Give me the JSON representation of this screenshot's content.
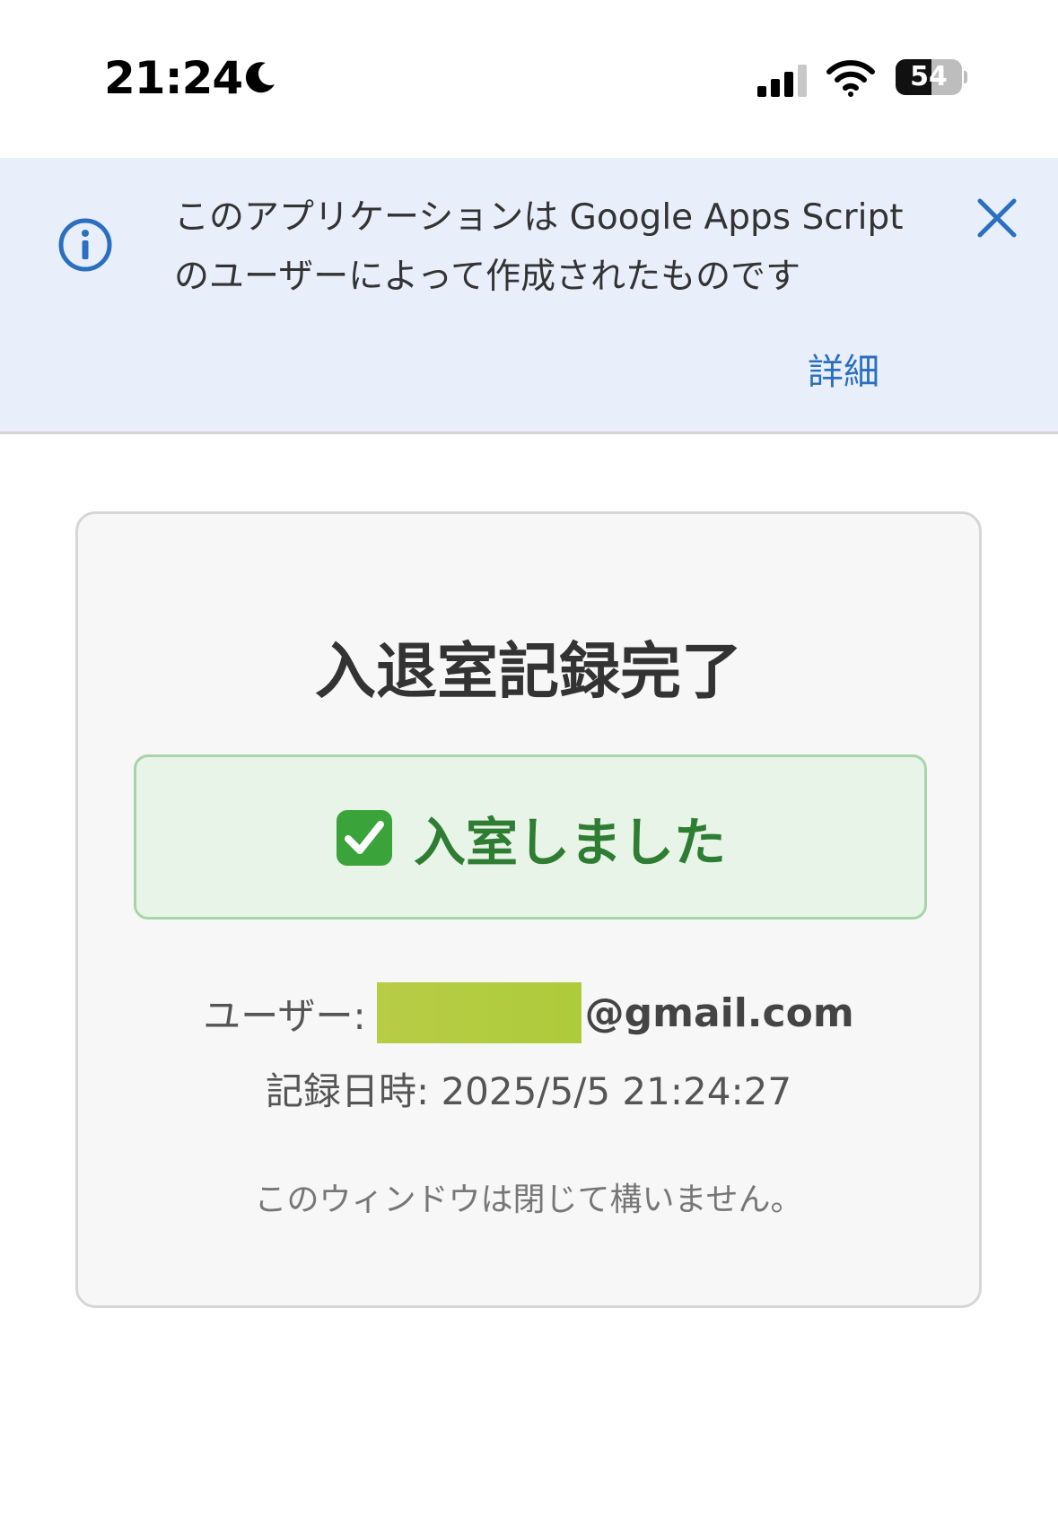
{
  "status_bar": {
    "time": "21:24",
    "battery_level": "54",
    "battery_fraction": 0.54,
    "icons": [
      "moon-icon",
      "cellular-signal-icon",
      "wifi-icon",
      "battery-icon"
    ]
  },
  "banner": {
    "line1": "このアプリケーションは Google Apps Script",
    "line2": "のユーザーによって作成されたものです",
    "details_label": "詳細",
    "icons": [
      "info-icon",
      "close-icon"
    ],
    "accent_color": "#2b6fbf",
    "background_color": "#e8effb"
  },
  "card": {
    "title": "入退室記録完了",
    "status_message": "入室しました",
    "status_icon": "check-box-icon",
    "user_label": "ユーザー:",
    "user_email_domain": "@gmail.com",
    "record_time": "記録日時: 2025/5/5 21:24:27",
    "close_note": "このウィンドウは閉じて構いません。",
    "status_color": "#2e7d32"
  }
}
